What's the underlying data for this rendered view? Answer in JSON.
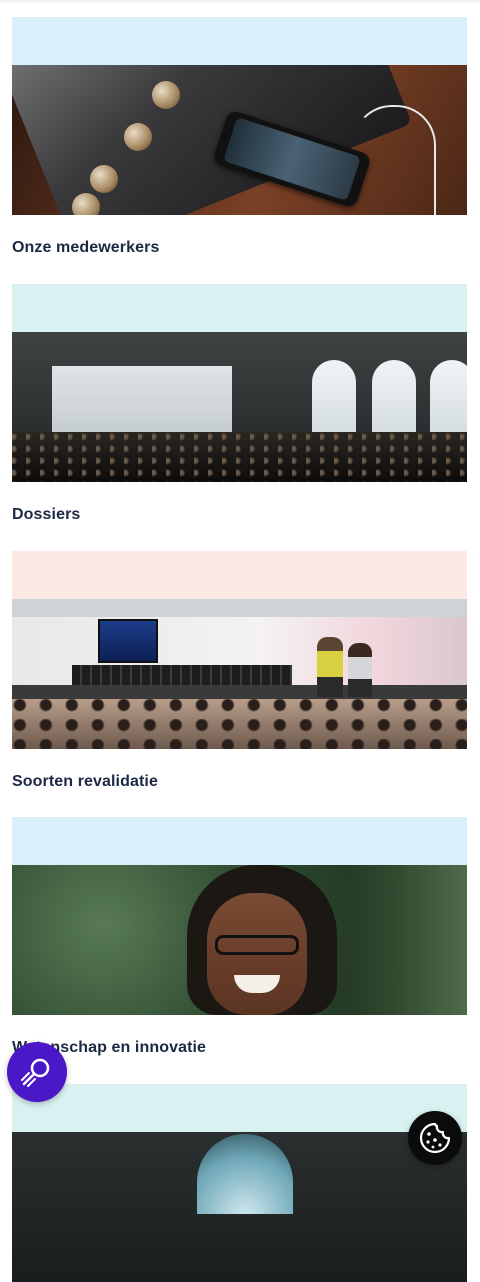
{
  "cards": [
    {
      "title": "Onze medewerkers",
      "bar_color": "#d9f0fa",
      "image": "phone-on-amplifier-photo"
    },
    {
      "title": "Dossiers",
      "bar_color": "#d9f1f1",
      "image": "cinema-hall-audience-photo"
    },
    {
      "title": "Soorten revalidatie",
      "bar_color": "#fde9e4",
      "image": "stage-event-audience-photo"
    },
    {
      "title": "Wetenschap en innovatie",
      "bar_color": "#d9f0fa",
      "image": "smiling-woman-glasses-photo"
    },
    {
      "title": "",
      "bar_color": "#d9f1f1",
      "image": "library-interior-photo"
    }
  ],
  "floating": {
    "accessibility_icon": "accessibility-magnifier-icon",
    "accessibility_color": "#4b18c8",
    "cookie_icon": "cookie-icon",
    "cookie_color": "#0b0b0b"
  }
}
